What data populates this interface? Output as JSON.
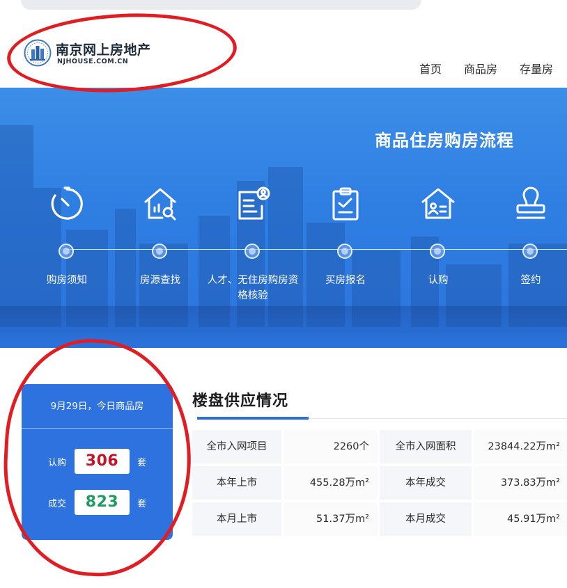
{
  "site": {
    "title": "南京网上房地产",
    "domain": "NJHOUSE.COM.CN"
  },
  "nav": [
    {
      "label": "首页"
    },
    {
      "label": "商品房"
    },
    {
      "label": "存量房"
    }
  ],
  "banner": {
    "title": "商品住房购房流程",
    "steps": [
      {
        "label": "购房须知",
        "icon": "timer-icon"
      },
      {
        "label": "房源查找",
        "icon": "house-search-icon"
      },
      {
        "label": "人才、无住房购房资格核验",
        "icon": "document-verify-icon"
      },
      {
        "label": "买房报名",
        "icon": "clipboard-check-icon"
      },
      {
        "label": "认购",
        "icon": "house-id-icon"
      },
      {
        "label": "签约",
        "icon": "stamp-icon"
      }
    ]
  },
  "today_stats": {
    "header": "9月29日，今日商品房",
    "rows": [
      {
        "label": "认购",
        "value": "306",
        "unit": "套",
        "color": "#c0152a"
      },
      {
        "label": "成交",
        "value": "823",
        "unit": "套",
        "color": "#1f9b63"
      }
    ]
  },
  "supply": {
    "title": "楼盘供应情况",
    "rows": [
      [
        {
          "label": "全市入网项目"
        },
        {
          "value": "2260个"
        },
        {
          "label": "全市入网面积"
        },
        {
          "value": "23844.22万m²"
        }
      ],
      [
        {
          "label": "本年上市"
        },
        {
          "value": "455.28万m²"
        },
        {
          "label": "本年成交"
        },
        {
          "value": "373.83万m²"
        }
      ],
      [
        {
          "label": "本月上市"
        },
        {
          "value": "51.37万m²"
        },
        {
          "label": "本月成交"
        },
        {
          "value": "45.91万m²"
        }
      ]
    ]
  },
  "colors": {
    "accent_blue": "#2e72df",
    "annotation_red": "#e11d24"
  }
}
